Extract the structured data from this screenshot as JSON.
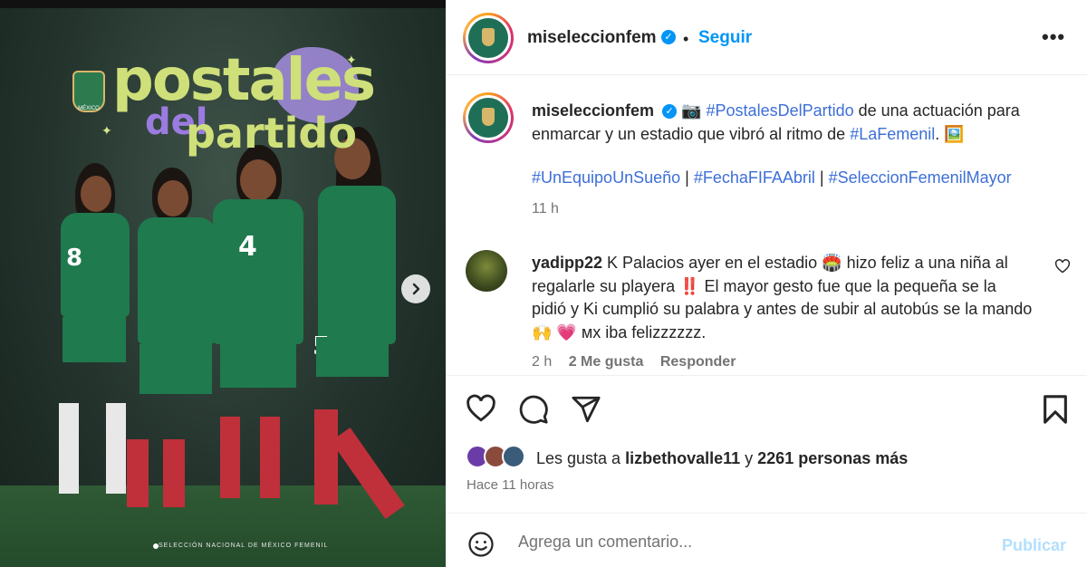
{
  "media": {
    "title_line1": "postales",
    "title_line2a": "del",
    "title_line2b": "partido",
    "crest_text": "MÉXICO",
    "credit": "SELECCIÓN NACIONAL DE MÉXICO FEMENIL",
    "player_numbers": [
      "8",
      "4",
      "5"
    ]
  },
  "header": {
    "username": "miseleccionfem",
    "separator": "•",
    "follow_label": "Seguir",
    "more_label": "•••"
  },
  "caption": {
    "username": "miseleccionfem",
    "camera_emoji": "📷",
    "hashtag_postales": "#PostalesDelPartido",
    "text_1": " de una actuación para enmarcar y un estadio que vibró al ritmo de ",
    "hashtag_lafemenil": "#LaFemenil",
    "text_2": ". 🖼️",
    "hashtag_1": "#UnEquipoUnSueño",
    "hashtag_2": "#FechaFIFAAbril",
    "hashtag_3": "#SeleccionFemenilMayor",
    "pipe": " | ",
    "time": "11 h"
  },
  "comment": {
    "username": "yadipp22",
    "text": "K Palacios ayer en el estadio 🏟️ hizo feliz a una niña al regalarle su playera ‼️ El mayor gesto fue que la pequeña se la pidió y Ki cumplió su palabra y antes de subir al autobús se la mando 🙌 💗 мх iba felizzzzzz.",
    "time": "2 h",
    "likes": "2 Me gusta",
    "reply_label": "Responder"
  },
  "likes": {
    "prefix": "Les gusta a ",
    "user": "lizbethovalle11",
    "conj": " y ",
    "count": "2261 personas más"
  },
  "posted_ago": "Hace 11 horas",
  "comment_bar": {
    "placeholder": "Agrega un comentario...",
    "publish_label": "Publicar"
  },
  "colors": {
    "accent_blue": "#0095f6",
    "hashtag_blue": "#3d6fd8",
    "publish_disabled": "#b2dffc",
    "muted_text": "#737373"
  },
  "icons": [
    "like-icon",
    "comment-icon",
    "share-icon",
    "save-icon",
    "emoji-icon",
    "verified-icon",
    "more-options-icon",
    "next-arrow-icon"
  ]
}
